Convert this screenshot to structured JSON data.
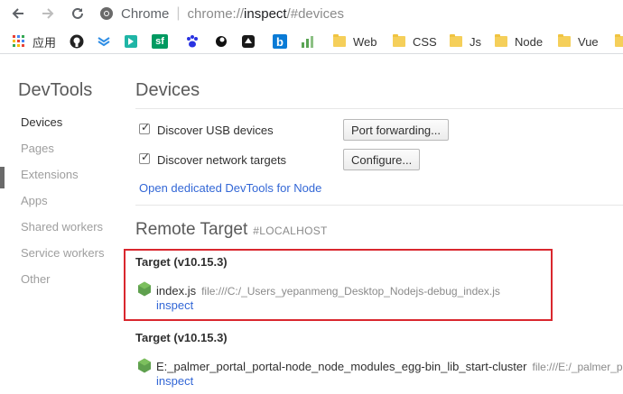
{
  "browser": {
    "address_site": "Chrome",
    "address_scheme": "chrome://",
    "address_host": "inspect",
    "address_path": "/#devices"
  },
  "bookmarks": [
    {
      "label": "应用",
      "icon": "apps-grid-icon"
    },
    {
      "label": "",
      "icon": "github-icon"
    },
    {
      "label": "",
      "icon": "bookmark-blue-icon"
    },
    {
      "label": "",
      "icon": "bookmark-teal-icon"
    },
    {
      "label": "",
      "icon": "sf-icon",
      "text": "sf"
    },
    {
      "label": "",
      "icon": "baidu-paw-icon"
    },
    {
      "label": "",
      "icon": "bookmark-black-icon"
    },
    {
      "label": "",
      "icon": "bookmark-dark-icon"
    },
    {
      "label": "",
      "icon": "bing-icon",
      "text": "b"
    },
    {
      "label": "",
      "icon": "bookmark-chart-icon"
    },
    {
      "label": "Web",
      "icon": "folder-icon"
    },
    {
      "label": "CSS",
      "icon": "folder-icon"
    },
    {
      "label": "Js",
      "icon": "folder-icon"
    },
    {
      "label": "Node",
      "icon": "folder-icon"
    },
    {
      "label": "Vue",
      "icon": "folder-icon"
    }
  ],
  "sidebar": {
    "title": "DevTools",
    "items": [
      {
        "label": "Devices",
        "active": true
      },
      {
        "label": "Pages"
      },
      {
        "label": "Extensions"
      },
      {
        "label": "Apps"
      },
      {
        "label": "Shared workers"
      },
      {
        "label": "Service workers"
      },
      {
        "label": "Other"
      }
    ]
  },
  "devices": {
    "title": "Devices",
    "discover_usb_label": "Discover USB devices",
    "discover_usb_checked": true,
    "port_forwarding_button": "Port forwarding...",
    "discover_network_label": "Discover network targets",
    "discover_network_checked": true,
    "configure_button": "Configure...",
    "open_node_devtools_link": "Open dedicated DevTools for Node"
  },
  "remote": {
    "title": "Remote Target",
    "subtitle": "#LOCALHOST",
    "targets": [
      {
        "header": "Target (v10.15.3)",
        "name": "index.js",
        "url": "file:///C:/_Users_yepanmeng_Desktop_Nodejs-debug_index.js",
        "action": "inspect"
      },
      {
        "header": "Target (v10.15.3)",
        "name": "E:_palmer_portal_portal-node_node_modules_egg-bin_lib_start-cluster",
        "url": "file:///E:/_palmer_po",
        "action": "inspect"
      }
    ]
  },
  "colors": {
    "link": "#3367d6",
    "highlight_border": "#d9272e",
    "node_green": "#5fa04e"
  }
}
